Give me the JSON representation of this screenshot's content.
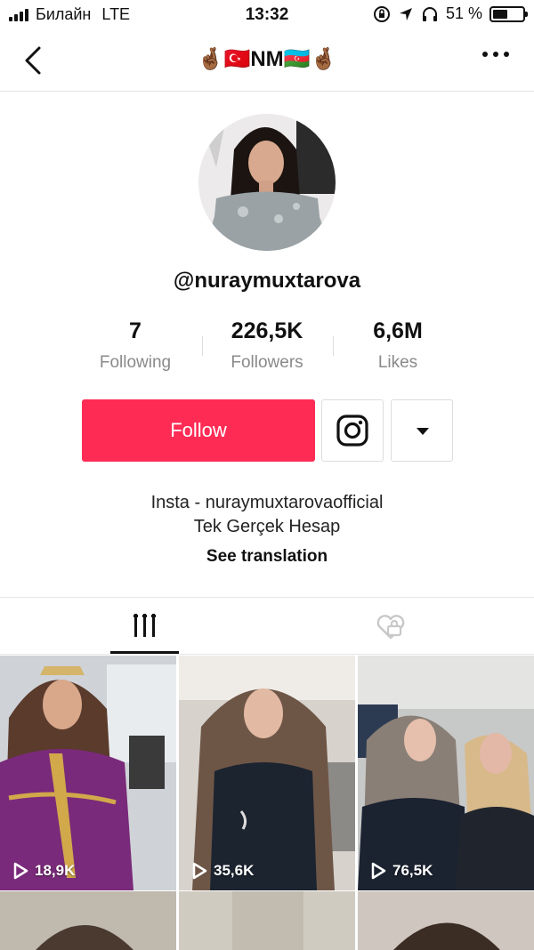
{
  "status_bar": {
    "carrier": "Билайн",
    "network": "LTE",
    "time": "13:32",
    "battery": "51 %",
    "battery_level": 0.51
  },
  "nav": {
    "title": "🤞🏾🇹🇷NM🇦🇿🤞🏾"
  },
  "profile": {
    "username": "@nuraymuxtarova",
    "stats": [
      {
        "value": "7",
        "label": "Following"
      },
      {
        "value": "226,5K",
        "label": "Followers"
      },
      {
        "value": "6,6M",
        "label": "Likes"
      }
    ],
    "follow_label": "Follow",
    "bio_line1": "Insta - nuraymuxtarovaofficial",
    "bio_line2": "Tek Gerçek Hesap",
    "see_translation": "See translation"
  },
  "videos": [
    {
      "views": "18,9K"
    },
    {
      "views": "35,6K"
    },
    {
      "views": "76,5K"
    }
  ],
  "icons": [
    "back-chevron-icon",
    "more-dots-icon",
    "instagram-icon",
    "dropdown-caret-icon",
    "grid-tab-icon",
    "liked-videos-icon",
    "play-icon"
  ],
  "colors": {
    "accent": "#fe2c55"
  }
}
